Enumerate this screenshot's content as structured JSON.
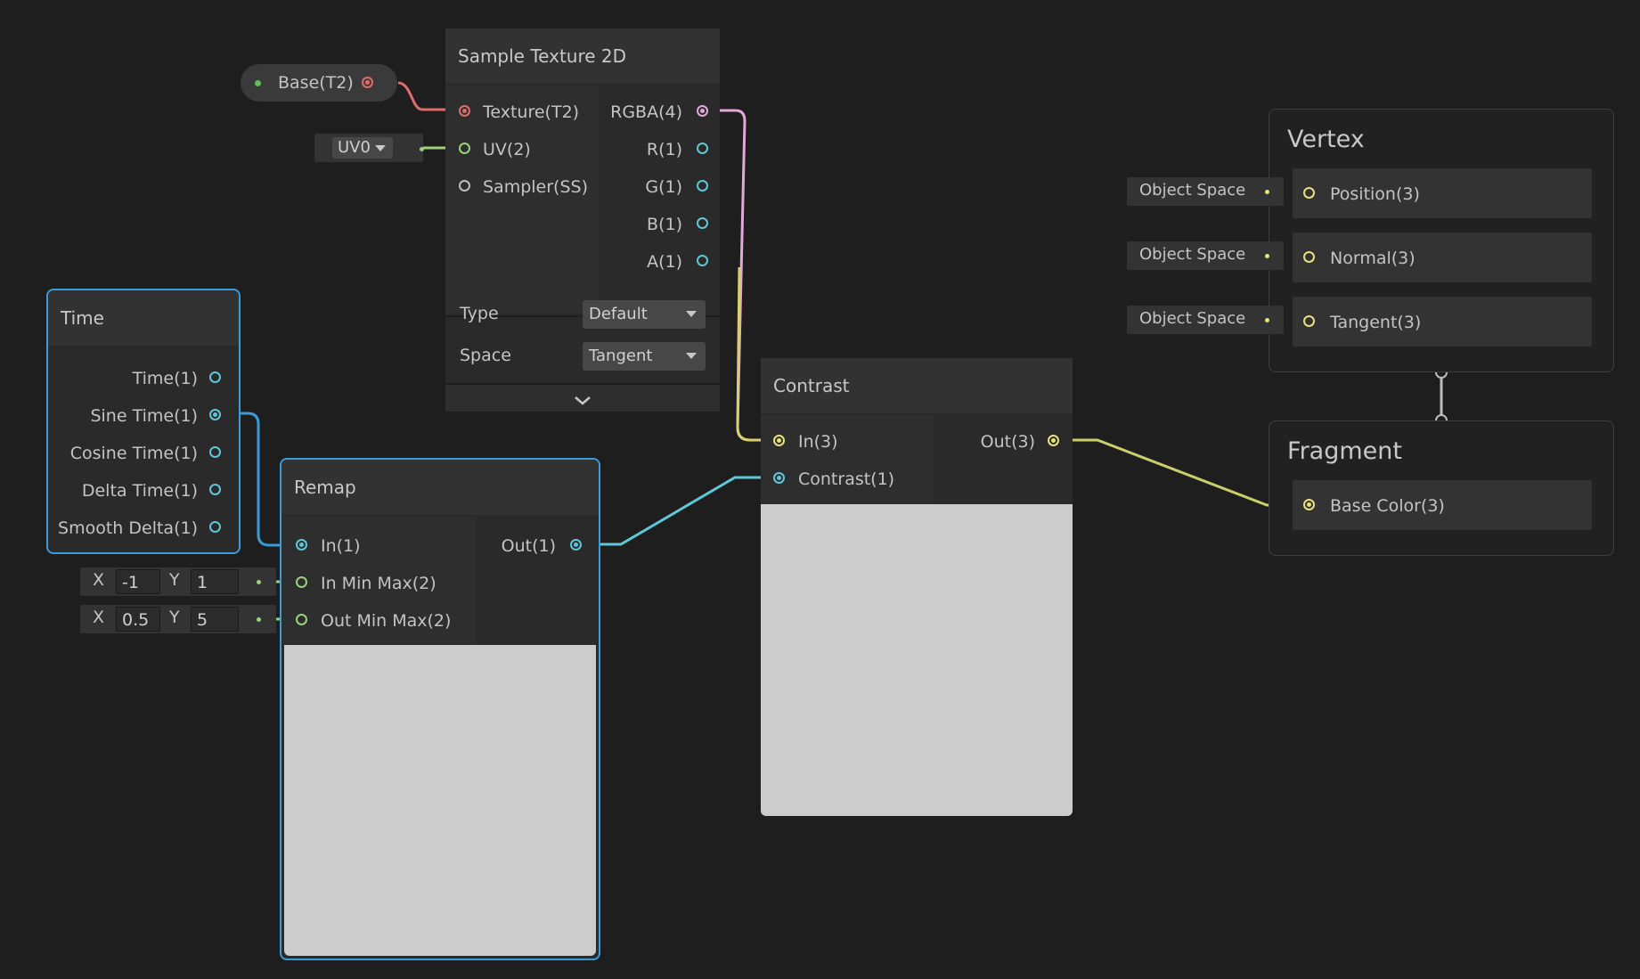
{
  "property_node": {
    "label": "Base(T2)"
  },
  "uv_chip": {
    "value": "UV0"
  },
  "sample_texture": {
    "title": "Sample Texture 2D",
    "inputs": [
      "Texture(T2)",
      "UV(2)",
      "Sampler(SS)"
    ],
    "outputs": [
      "RGBA(4)",
      "R(1)",
      "G(1)",
      "B(1)",
      "A(1)"
    ],
    "type_label": "Type",
    "type_value": "Default",
    "space_label": "Space",
    "space_value": "Tangent"
  },
  "time_node": {
    "title": "Time",
    "outputs": [
      "Time(1)",
      "Sine Time(1)",
      "Cosine Time(1)",
      "Delta Time(1)",
      "Smooth Delta(1)"
    ]
  },
  "remap_node": {
    "title": "Remap",
    "inputs": [
      "In(1)",
      "In Min Max(2)",
      "Out Min Max(2)"
    ],
    "output": "Out(1)",
    "in_min_max": {
      "x_label": "X",
      "x": "-1",
      "y_label": "Y",
      "y": "1"
    },
    "out_min_max": {
      "x_label": "X",
      "x": "0.5",
      "y_label": "Y",
      "y": "5"
    }
  },
  "contrast_node": {
    "title": "Contrast",
    "inputs": [
      "In(3)",
      "Contrast(1)"
    ],
    "output": "Out(3)"
  },
  "vertex_context": {
    "title": "Vertex",
    "blocks": [
      "Position(3)",
      "Normal(3)",
      "Tangent(3)"
    ],
    "space_chip": "Object Space"
  },
  "fragment_context": {
    "title": "Fragment",
    "blocks": [
      "Base Color(3)"
    ]
  },
  "colors": {
    "texture_port": "#e06c6c",
    "vector1_port": "#5ec8d8",
    "vector2_port": "#9ad27a",
    "vector3_port": "#e8e27a",
    "vector4_port": "#e4a8d8",
    "selection": "#3a9bd9"
  }
}
